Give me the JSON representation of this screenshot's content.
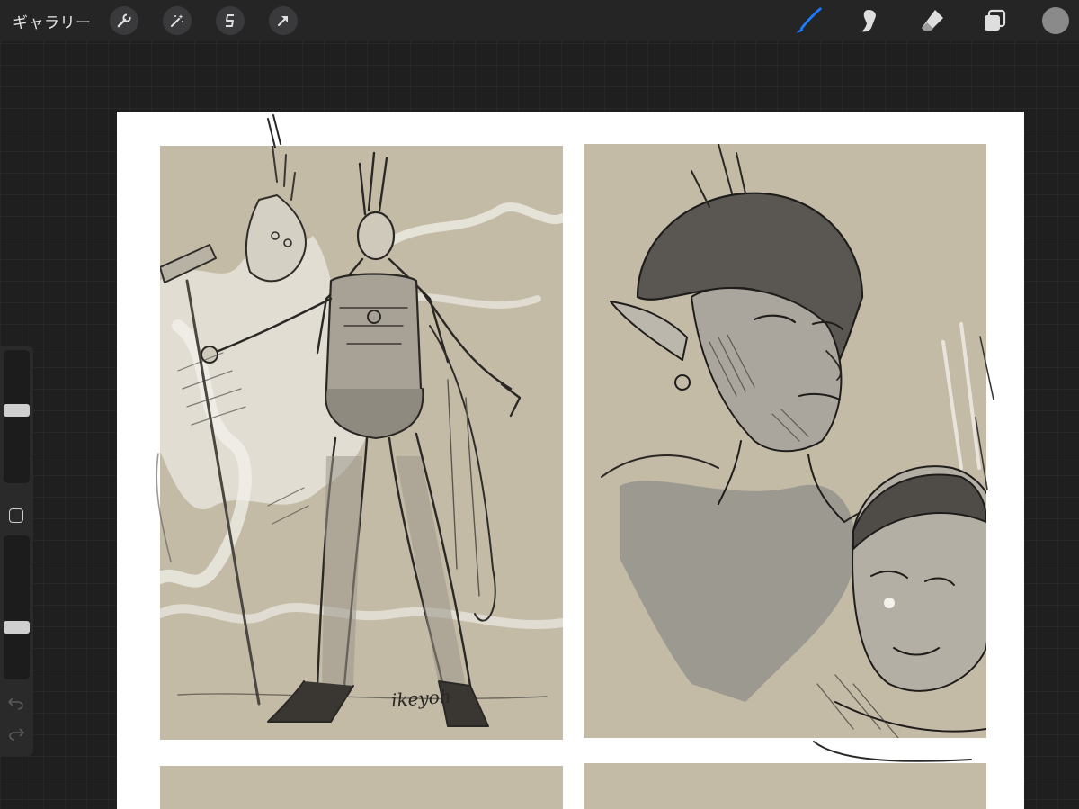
{
  "toolbar": {
    "gallery_label": "ギャラリー",
    "left_tools": [
      "wrench-icon",
      "magic-wand-icon",
      "selection-icon",
      "transform-arrow-icon"
    ],
    "right_tools": [
      "brush-icon",
      "smudge-icon",
      "eraser-icon",
      "layers-icon"
    ],
    "active_tool": "brush-icon",
    "accent_color": "#1a7cff",
    "current_color": "#8a8a8a"
  },
  "sidebar": {
    "brush_size_level": 0.55,
    "opacity_level": 0.35,
    "icons": [
      "modify-square-icon",
      "undo-icon",
      "redo-icon"
    ]
  },
  "canvas": {
    "background_color": "#ffffff",
    "panel_color": "#c4bba7",
    "signature_text": "ikeyoh"
  }
}
